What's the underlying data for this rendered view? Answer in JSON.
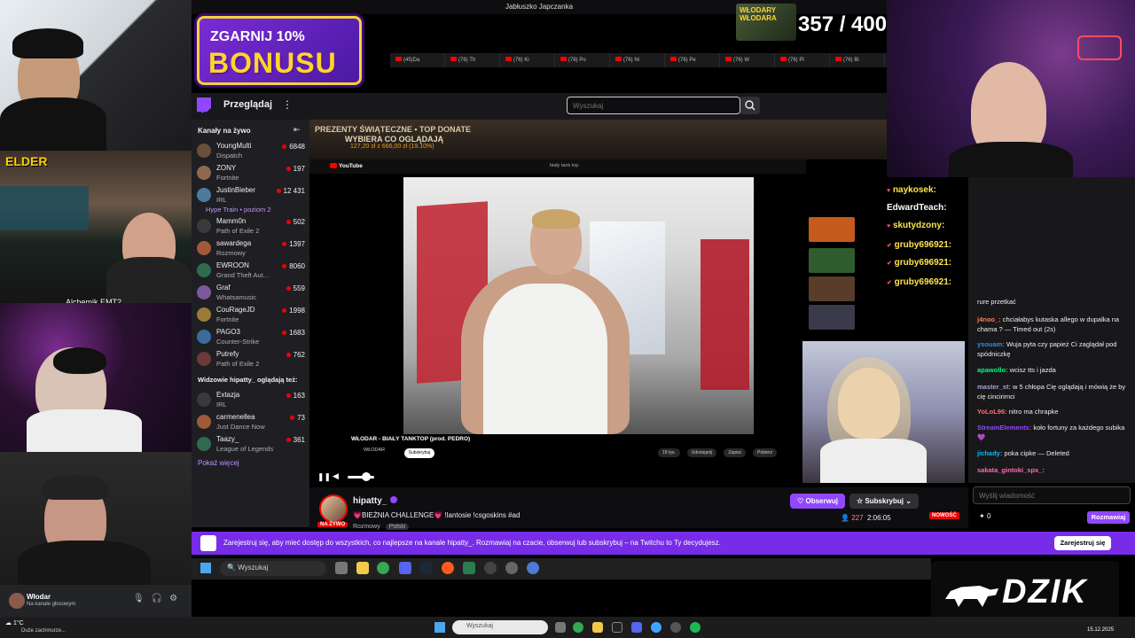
{
  "window": {
    "title": "Jabłuszko Japczanka"
  },
  "promo": {
    "line1": "ZGARNIJ 10%",
    "line2": "BONUSU"
  },
  "counter": {
    "text": "357 / 400",
    "image_label": "WŁODARY WŁODARA"
  },
  "browser_tabs": [
    "(45)Da",
    "(76) Th",
    "(76) Ki",
    "(76) Po",
    "(76) Ni",
    "(76) Pe",
    "(76) W",
    "(76) Pl",
    "(76) Bi"
  ],
  "twitch": {
    "browse": "Przeglądaj",
    "search_placeholder": "Wyszukaj",
    "sidebar": {
      "header": "Kanały na żywo",
      "channels": [
        {
          "name": "YoungMulti",
          "category": "Dispatch",
          "viewers": "6848"
        },
        {
          "name": "ZONY",
          "category": "Fortnite",
          "viewers": "197"
        },
        {
          "name": "JustinBieber",
          "category": "IRL",
          "viewers": "12 431",
          "extra": "Hype Train • poziom 2"
        },
        {
          "name": "Mamm0n",
          "category": "Path of Exile 2",
          "viewers": "502"
        },
        {
          "name": "sawardega",
          "category": "Rozmowy",
          "viewers": "1397"
        },
        {
          "name": "EWROON",
          "category": "Grand Theft Aut...",
          "viewers": "8060"
        },
        {
          "name": "Graf",
          "category": "Whatsamusic",
          "viewers": "559"
        },
        {
          "name": "CouRageJD",
          "category": "Fortnite",
          "viewers": "1998"
        },
        {
          "name": "PAGO3",
          "category": "Counter-Strike",
          "viewers": "1683"
        },
        {
          "name": "Putrefy",
          "category": "Path of Exile 2",
          "viewers": "762"
        }
      ],
      "also_watching": "Widzowie hipatty_ oglądają też:",
      "also_channels": [
        {
          "name": "Extazja",
          "category": "IRL",
          "viewers": "163"
        },
        {
          "name": "carmenellea",
          "category": "Just Dance Now",
          "viewers": "73"
        },
        {
          "name": "Taazy_",
          "category": "League of Legends",
          "viewers": "361"
        }
      ],
      "show_more": "Pokaż więcej"
    },
    "donate": {
      "title": "PREZENTY ŚWIĄTECZNE • TOP DONATE",
      "subtitle": "WYBIERA CO OGLĄDAJĄ",
      "amount": "127,20 zł z 666,00 zł (19.10%)"
    },
    "youtube": {
      "logo": "YouTube",
      "query": "biały tank top",
      "video_title": "WŁODAR - BIAŁY TANKTOP (prod. PEDRO)",
      "channel": "WŁODAR",
      "subscribe": "Subskrybuj",
      "actions": [
        "19 tys.",
        "Udostępnij",
        "Zapisz",
        "Pobierz"
      ]
    },
    "streamer": {
      "name": "hipatty_",
      "title": "💗BIEŻNIA CHALLENGE💗 !lantosie !csgoskins #ad",
      "category": "Rozmowy",
      "tag": "Polski",
      "live": "NA ŻYWO",
      "follow": "Obserwuj",
      "subscribe": "Subskrybuj",
      "viewers": "227",
      "uptime": "2:06:05",
      "badge": "NOWOŚĆ"
    },
    "alerts": [
      "naykosek:",
      "EdwardTeach:",
      "skutydzony:",
      "gruby696921:",
      "gruby696921:",
      "gruby696921:"
    ],
    "chat": [
      {
        "user": "",
        "text": "rure przetkać",
        "faded": false
      },
      {
        "user": "j4noo_:",
        "text": "chciałabys kutaska allego w dupalka na chama ? — Timed out (2s)",
        "faded": false
      },
      {
        "user": "ysouam:",
        "text": "Wuja pyta czy papież Ci zaglądał pod spódniczkę",
        "faded": false
      },
      {
        "user": "apawollo:",
        "text": "wcisz tts i jazda",
        "faded": false
      },
      {
        "user": "master_st:",
        "text": "w 5 chłopa Cię oglądają i mówią że by cię cincirimci",
        "faded": false
      },
      {
        "user": "YoLoL96:",
        "text": "nitro ma chrapke",
        "faded": false
      },
      {
        "user": "StreamElements:",
        "text": "koło fortuny za każdego subika 💜",
        "faded": false
      },
      {
        "user": "jichady:",
        "text": "poka cipke — Deleted",
        "faded": false
      },
      {
        "user": "sakata_gintoki_spx_:",
        "text": "",
        "faded": false
      }
    ],
    "chat_placeholder": "Wyślij wiadomość",
    "chat_send": "Rozmawiaj",
    "chat_points": "0",
    "banner": "Zarejestruj się, aby mieć dostęp do wszystkich, co najlepsze na kanale hipatty_. Rozmawiaj na czacie, obserwuj lub subskrybuj – na Twitchu to Ty decydujesz.",
    "register": "Zarejestruj się"
  },
  "inner_taskbar": {
    "search": "Wyszukaj"
  },
  "discord": {
    "name": "Włodar",
    "status": "Na kanale głosowym"
  },
  "brand": {
    "text": "DZIK"
  },
  "taskbar": {
    "weather": "1°C",
    "weather_desc": "Duże zachmurze...",
    "search": "Wyszukaj",
    "date": "15.12.2025"
  },
  "colors": {
    "twitch_purple": "#9147ff",
    "live_red": "#eb0400"
  }
}
